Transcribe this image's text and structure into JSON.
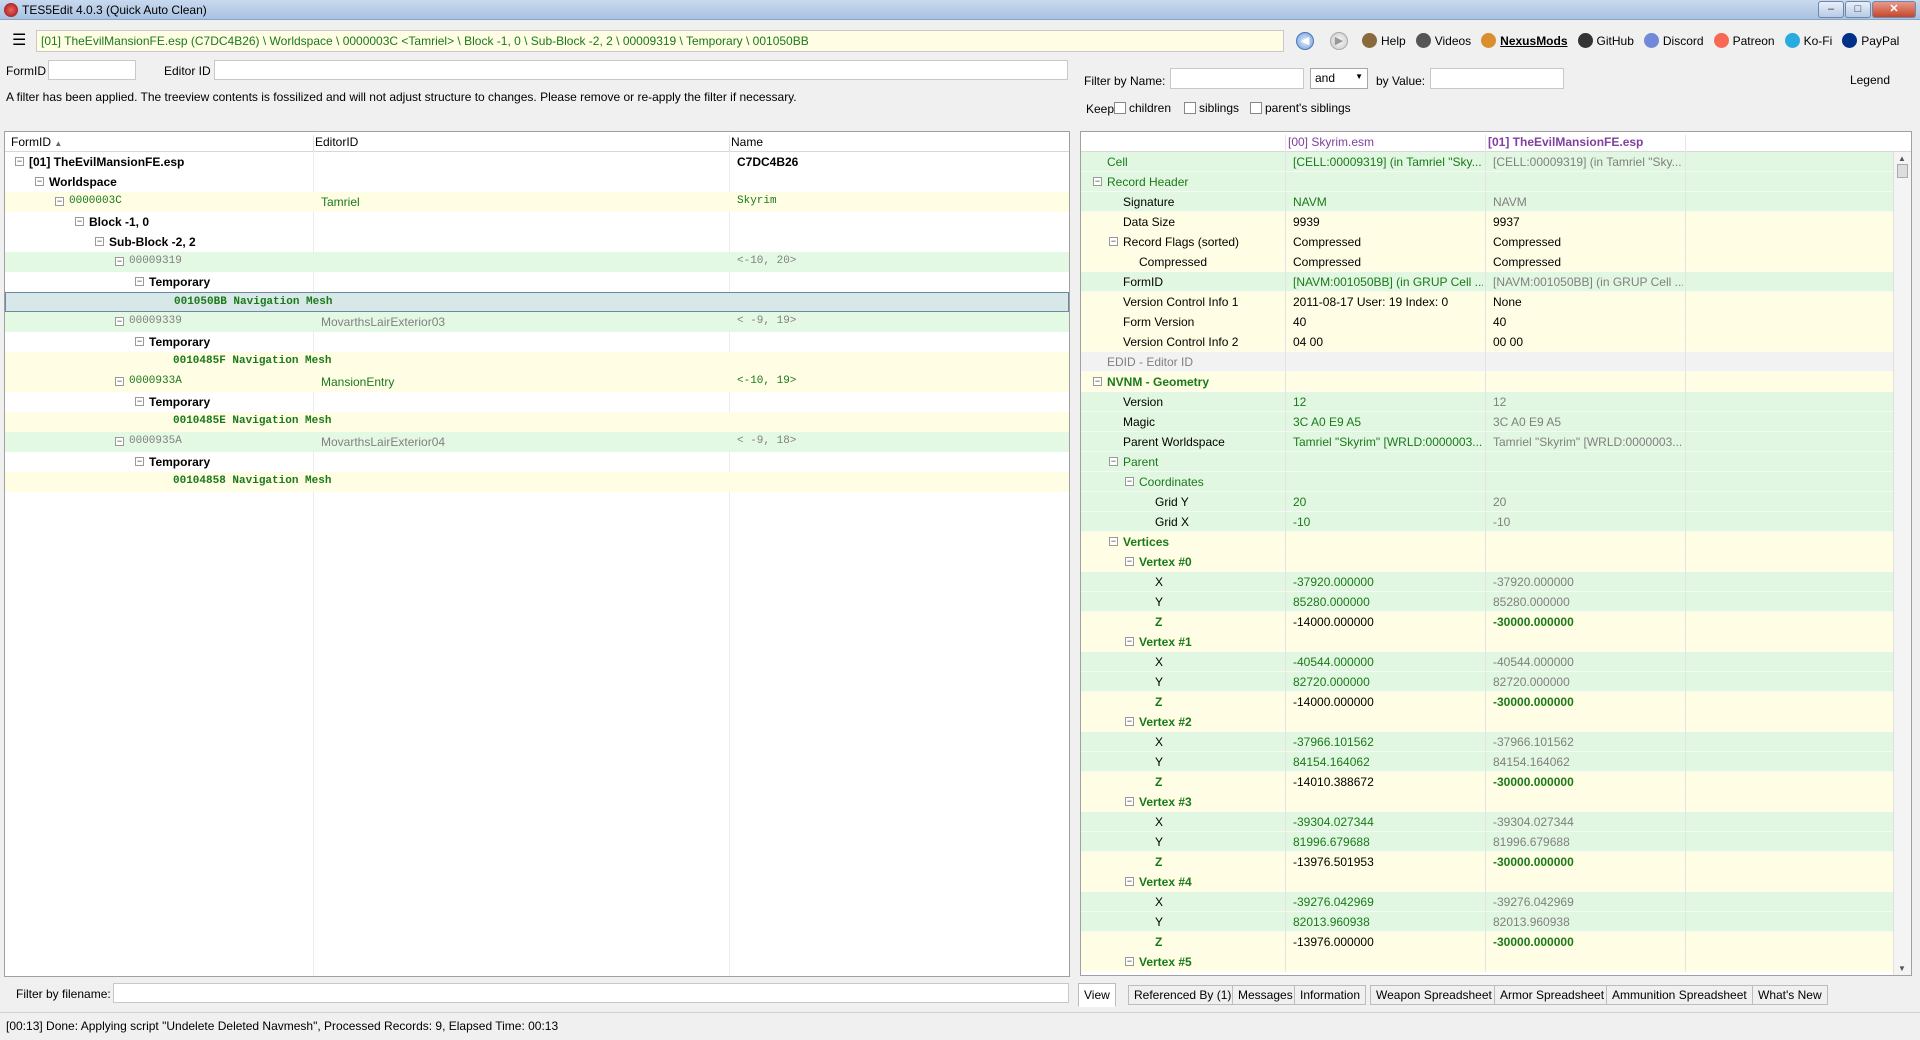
{
  "window": {
    "title": "TES5Edit 4.0.3 (Quick Auto Clean)"
  },
  "path": "[01] TheEvilMansionFE.esp (C7DC4B26) \\ Worldspace \\ 0000003C <Tamriel> \\ Block -1, 0 \\ Sub-Block -2, 2 \\ 00009319 \\ Temporary \\ 001050BB",
  "toolbar": [
    {
      "label": "Help",
      "icon": "book-icon",
      "color": "#8a6a3a"
    },
    {
      "label": "Videos",
      "icon": "video-icon",
      "color": "#555555"
    },
    {
      "label": "NexusMods",
      "icon": "nexus-icon",
      "color": "#d98f2b"
    },
    {
      "label": "GitHub",
      "icon": "github-icon",
      "color": "#333333"
    },
    {
      "label": "Discord",
      "icon": "discord-icon",
      "color": "#7289da"
    },
    {
      "label": "Patreon",
      "icon": "patreon-icon",
      "color": "#f96854"
    },
    {
      "label": "Ko-Fi",
      "icon": "kofi-icon",
      "color": "#29abe0"
    },
    {
      "label": "PayPal",
      "icon": "paypal-icon",
      "color": "#003087"
    }
  ],
  "left": {
    "formid_label": "FormID",
    "editorid_label": "Editor ID",
    "filter_message": "A filter has been applied. The treeview contents is fossilized and will not adjust structure to changes.  Please remove or re-apply the filter if necessary.",
    "columns": [
      "FormID",
      "EditorID",
      "Name"
    ],
    "rows": [
      {
        "formid": "[01] TheEvilMansionFE.esp",
        "editorid": "",
        "name": "C7DC4B26",
        "style": "bold",
        "bg": "white",
        "mono": false
      },
      {
        "formid": "Worldspace",
        "editorid": "",
        "name": "",
        "style": "bold",
        "bg": "white",
        "mono": false
      },
      {
        "formid": "0000003C",
        "editorid": "Tamriel",
        "name": "Skyrim",
        "style": "green",
        "bg": "yellow",
        "mono": true
      },
      {
        "formid": "Block -1, 0",
        "editorid": "",
        "name": "",
        "style": "bold",
        "bg": "white",
        "mono": false
      },
      {
        "formid": "Sub-Block -2, 2",
        "editorid": "",
        "name": "",
        "style": "bold",
        "bg": "white",
        "mono": false
      },
      {
        "formid": "00009319",
        "editorid": "",
        "name": "<-10, 20>",
        "style": "gray",
        "bg": "green",
        "mono": true
      },
      {
        "formid": "Temporary",
        "editorid": "",
        "name": "",
        "style": "bold",
        "bg": "white",
        "mono": false
      },
      {
        "formid": "001050BB  Navigation Mesh",
        "editorid": "",
        "name": "",
        "style": "dgreen",
        "bg": "sel",
        "mono": true
      },
      {
        "formid": "00009339",
        "editorid": "MovarthsLairExterior03",
        "name": "< -9, 19>",
        "style": "gray",
        "bg": "green",
        "mono": true
      },
      {
        "formid": "Temporary",
        "editorid": "",
        "name": "",
        "style": "bold",
        "bg": "white",
        "mono": false
      },
      {
        "formid": "0010485F  Navigation Mesh",
        "editorid": "",
        "name": "",
        "style": "dgreen",
        "bg": "yellow",
        "mono": true
      },
      {
        "formid": "0000933A",
        "editorid": "MansionEntry",
        "name": "<-10, 19>",
        "style": "green",
        "bg": "yellow",
        "mono": true
      },
      {
        "formid": "Temporary",
        "editorid": "",
        "name": "",
        "style": "bold",
        "bg": "white",
        "mono": false
      },
      {
        "formid": "0010485E  Navigation Mesh",
        "editorid": "",
        "name": "",
        "style": "dgreen",
        "bg": "yellow",
        "mono": true
      },
      {
        "formid": "0000935A",
        "editorid": "MovarthsLairExterior04",
        "name": "< -9, 18>",
        "style": "gray",
        "bg": "green",
        "mono": true
      },
      {
        "formid": "Temporary",
        "editorid": "",
        "name": "",
        "style": "bold",
        "bg": "white",
        "mono": false
      },
      {
        "formid": "00104858  Navigation Mesh",
        "editorid": "",
        "name": "",
        "style": "dgreen",
        "bg": "yellow",
        "mono": true
      }
    ],
    "filename_filter_label": "Filter by filename:"
  },
  "right": {
    "filter_by_name_label": "Filter by Name:",
    "operator_value": "and",
    "by_value_label": "by Value:",
    "legend_label": "Legend",
    "keep_label": "Keep",
    "keep_options": [
      "children",
      "siblings",
      "parent's siblings"
    ],
    "columns": [
      "[00] Skyrim.esm",
      "[01] TheEvilMansionFE.esp"
    ],
    "rows": [
      {
        "name": "Cell",
        "v1": "[CELL:00009319] (in Tamriel \"Sky...",
        "v2": "[CELL:00009319] (in Tamriel \"Sky...",
        "bg": "g",
        "nc": "g",
        "c1": "g",
        "c2": "gray",
        "b2": false
      },
      {
        "name": "Record Header",
        "v1": "",
        "v2": "",
        "bg": "g",
        "nc": "g",
        "c1": "",
        "c2": "",
        "b2": false
      },
      {
        "name": "Signature",
        "v1": "NAVM",
        "v2": "NAVM",
        "bg": "g",
        "nc": "",
        "c1": "g",
        "c2": "gray",
        "b2": false
      },
      {
        "name": "Data Size",
        "v1": "9939",
        "v2": "9937",
        "bg": "y",
        "nc": "",
        "c1": "",
        "c2": "",
        "b2": false
      },
      {
        "name": "Record Flags (sorted)",
        "v1": "Compressed",
        "v2": "Compressed",
        "bg": "y",
        "nc": "",
        "c1": "",
        "c2": "",
        "b2": false
      },
      {
        "name": "Compressed",
        "v1": "Compressed",
        "v2": "Compressed",
        "bg": "y",
        "nc": "",
        "c1": "",
        "c2": "",
        "b2": false
      },
      {
        "name": "FormID",
        "v1": "[NAVM:001050BB] (in GRUP Cell ...",
        "v2": "[NAVM:001050BB] (in GRUP Cell ...",
        "bg": "g",
        "nc": "",
        "c1": "g",
        "c2": "gray",
        "b2": false
      },
      {
        "name": "Version Control Info 1",
        "v1": "2011-08-17 User: 19 Index: 0",
        "v2": "None",
        "bg": "y",
        "nc": "",
        "c1": "",
        "c2": "",
        "b2": false
      },
      {
        "name": "Form Version",
        "v1": "40",
        "v2": "40",
        "bg": "y",
        "nc": "",
        "c1": "",
        "c2": "",
        "b2": false
      },
      {
        "name": "Version Control Info 2",
        "v1": "04 00",
        "v2": "00 00",
        "bg": "y",
        "nc": "",
        "c1": "",
        "c2": "",
        "b2": false
      },
      {
        "name": "EDID - Editor ID",
        "v1": "",
        "v2": "",
        "bg": "gr",
        "nc": "gray",
        "c1": "",
        "c2": "",
        "b2": false
      },
      {
        "name": "NVNM - Geometry",
        "v1": "",
        "v2": "",
        "bg": "y",
        "nc": "dg",
        "c1": "",
        "c2": "",
        "b2": false
      },
      {
        "name": "Version",
        "v1": "12",
        "v2": "12",
        "bg": "g",
        "nc": "",
        "c1": "g",
        "c2": "gray",
        "b2": false
      },
      {
        "name": "Magic",
        "v1": "3C A0 E9 A5",
        "v2": "3C A0 E9 A5",
        "bg": "g",
        "nc": "",
        "c1": "g",
        "c2": "gray",
        "b2": false
      },
      {
        "name": "Parent Worldspace",
        "v1": "Tamriel \"Skyrim\" [WRLD:0000003...",
        "v2": "Tamriel \"Skyrim\" [WRLD:0000003...",
        "bg": "g",
        "nc": "",
        "c1": "g",
        "c2": "gray",
        "b2": false
      },
      {
        "name": "Parent",
        "v1": "",
        "v2": "",
        "bg": "g",
        "nc": "g",
        "c1": "",
        "c2": "",
        "b2": false
      },
      {
        "name": "Coordinates",
        "v1": "",
        "v2": "",
        "bg": "g",
        "nc": "g",
        "c1": "",
        "c2": "",
        "b2": false
      },
      {
        "name": "Grid Y",
        "v1": "20",
        "v2": "20",
        "bg": "g",
        "nc": "",
        "c1": "g",
        "c2": "gray",
        "b2": false
      },
      {
        "name": "Grid X",
        "v1": "-10",
        "v2": "-10",
        "bg": "g",
        "nc": "",
        "c1": "g",
        "c2": "gray",
        "b2": false
      },
      {
        "name": "Vertices",
        "v1": "",
        "v2": "",
        "bg": "y",
        "nc": "dg",
        "c1": "",
        "c2": "",
        "b2": false
      },
      {
        "name": "Vertex #0",
        "v1": "",
        "v2": "",
        "bg": "y",
        "nc": "dg",
        "c1": "",
        "c2": "",
        "b2": false
      },
      {
        "name": "X",
        "v1": "-37920.000000",
        "v2": "-37920.000000",
        "bg": "g",
        "nc": "",
        "c1": "g",
        "c2": "gray",
        "b2": false
      },
      {
        "name": "Y",
        "v1": "85280.000000",
        "v2": "85280.000000",
        "bg": "g",
        "nc": "",
        "c1": "g",
        "c2": "gray",
        "b2": false
      },
      {
        "name": "Z",
        "v1": "-14000.000000",
        "v2": "-30000.000000",
        "bg": "y",
        "nc": "dg",
        "c1": "",
        "c2": "dg",
        "b2": true
      },
      {
        "name": "Vertex #1",
        "v1": "",
        "v2": "",
        "bg": "y",
        "nc": "dg",
        "c1": "",
        "c2": "",
        "b2": false
      },
      {
        "name": "X",
        "v1": "-40544.000000",
        "v2": "-40544.000000",
        "bg": "g",
        "nc": "",
        "c1": "g",
        "c2": "gray",
        "b2": false
      },
      {
        "name": "Y",
        "v1": "82720.000000",
        "v2": "82720.000000",
        "bg": "g",
        "nc": "",
        "c1": "g",
        "c2": "gray",
        "b2": false
      },
      {
        "name": "Z",
        "v1": "-14000.000000",
        "v2": "-30000.000000",
        "bg": "y",
        "nc": "dg",
        "c1": "",
        "c2": "dg",
        "b2": true
      },
      {
        "name": "Vertex #2",
        "v1": "",
        "v2": "",
        "bg": "y",
        "nc": "dg",
        "c1": "",
        "c2": "",
        "b2": false
      },
      {
        "name": "X",
        "v1": "-37966.101562",
        "v2": "-37966.101562",
        "bg": "g",
        "nc": "",
        "c1": "g",
        "c2": "gray",
        "b2": false
      },
      {
        "name": "Y",
        "v1": "84154.164062",
        "v2": "84154.164062",
        "bg": "g",
        "nc": "",
        "c1": "g",
        "c2": "gray",
        "b2": false
      },
      {
        "name": "Z",
        "v1": "-14010.388672",
        "v2": "-30000.000000",
        "bg": "y",
        "nc": "dg",
        "c1": "",
        "c2": "dg",
        "b2": true
      },
      {
        "name": "Vertex #3",
        "v1": "",
        "v2": "",
        "bg": "y",
        "nc": "dg",
        "c1": "",
        "c2": "",
        "b2": false
      },
      {
        "name": "X",
        "v1": "-39304.027344",
        "v2": "-39304.027344",
        "bg": "g",
        "nc": "",
        "c1": "g",
        "c2": "gray",
        "b2": false
      },
      {
        "name": "Y",
        "v1": "81996.679688",
        "v2": "81996.679688",
        "bg": "g",
        "nc": "",
        "c1": "g",
        "c2": "gray",
        "b2": false
      },
      {
        "name": "Z",
        "v1": "-13976.501953",
        "v2": "-30000.000000",
        "bg": "y",
        "nc": "dg",
        "c1": "",
        "c2": "dg",
        "b2": true
      },
      {
        "name": "Vertex #4",
        "v1": "",
        "v2": "",
        "bg": "y",
        "nc": "dg",
        "c1": "",
        "c2": "",
        "b2": false
      },
      {
        "name": "X",
        "v1": "-39276.042969",
        "v2": "-39276.042969",
        "bg": "g",
        "nc": "",
        "c1": "g",
        "c2": "gray",
        "b2": false
      },
      {
        "name": "Y",
        "v1": "82013.960938",
        "v2": "82013.960938",
        "bg": "g",
        "nc": "",
        "c1": "g",
        "c2": "gray",
        "b2": false
      },
      {
        "name": "Z",
        "v1": "-13976.000000",
        "v2": "-30000.000000",
        "bg": "y",
        "nc": "dg",
        "c1": "",
        "c2": "dg",
        "b2": true
      },
      {
        "name": "Vertex #5",
        "v1": "",
        "v2": "",
        "bg": "y",
        "nc": "dg",
        "c1": "",
        "c2": "",
        "b2": false
      }
    ],
    "tabs": [
      "View",
      "Referenced By (1)",
      "Messages",
      "Information",
      "Weapon Spreadsheet",
      "Armor Spreadsheet",
      "Ammunition Spreadsheet",
      "What's New"
    ]
  },
  "status": "[00:13] Done: Applying script \"Undelete Deleted Navmesh\", Processed Records: 9, Elapsed Time: 00:13"
}
